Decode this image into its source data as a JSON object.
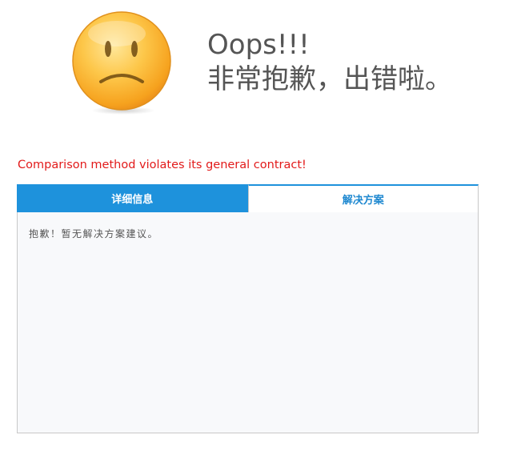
{
  "header": {
    "title_line1": "Oops!!!",
    "title_line2": "非常抱歉，出错啦。"
  },
  "error": {
    "message": "Comparison method violates its general contract!",
    "color": "#e21a1a"
  },
  "tabs": [
    {
      "label": "详细信息",
      "active": true
    },
    {
      "label": "解决方案",
      "active": false
    }
  ],
  "panel": {
    "text": "抱歉！暂无解决方案建议。"
  },
  "icons": {
    "face": "sad-face-icon"
  },
  "colors": {
    "accent": "#1e92dc",
    "face_yellow": "#f7b733",
    "face_outline": "#e89a1a"
  }
}
